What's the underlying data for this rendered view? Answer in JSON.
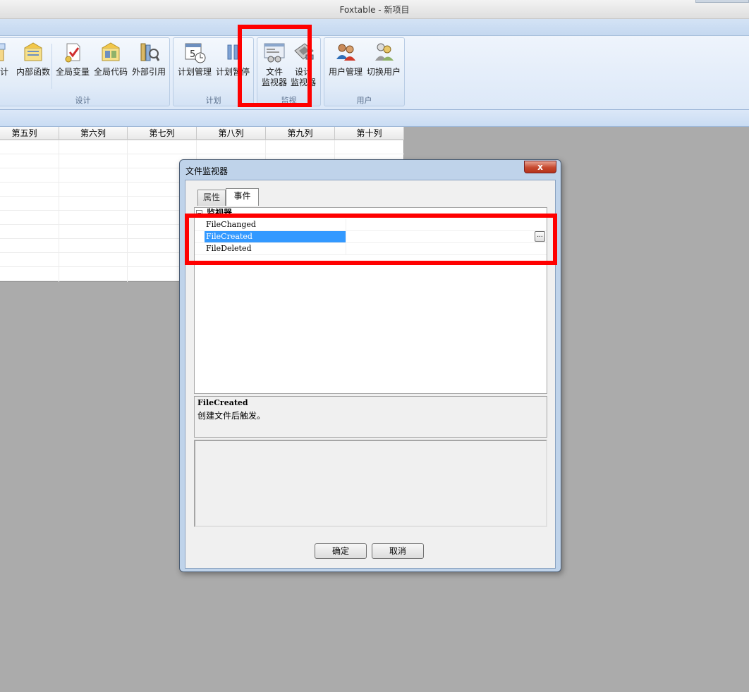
{
  "window": {
    "title": "Foxtable - 新项目"
  },
  "ribbon": {
    "groups": [
      {
        "label": "设计",
        "buttons": [
          {
            "label": "计",
            "icon": "design-icon"
          },
          {
            "label": "内部函数",
            "icon": "internal-function-icon"
          },
          {
            "label": "全局变量",
            "icon": "global-variable-icon"
          },
          {
            "label": "全局代码",
            "icon": "global-code-icon"
          },
          {
            "label": "外部引用",
            "icon": "external-reference-icon"
          }
        ]
      },
      {
        "label": "计划",
        "buttons": [
          {
            "label": "计划管理",
            "icon": "calendar-clock-icon"
          },
          {
            "label": "计划暂停",
            "icon": "pause-icon"
          }
        ]
      },
      {
        "label": "监视",
        "buttons": [
          {
            "label": "文件\n监视器",
            "icon": "file-monitor-icon"
          },
          {
            "label": "设计\n监视器",
            "icon": "design-monitor-icon"
          }
        ]
      },
      {
        "label": "用户",
        "buttons": [
          {
            "label": "用户管理",
            "icon": "user-management-icon"
          },
          {
            "label": "切换用户",
            "icon": "switch-user-icon"
          }
        ]
      }
    ]
  },
  "grid": {
    "columns": [
      "第五列",
      "第六列",
      "第七列",
      "第八列",
      "第九列",
      "第十列"
    ]
  },
  "dialog": {
    "title": "文件监视器",
    "close_label": "x",
    "tabs": [
      "属性",
      "事件"
    ],
    "active_tab": "事件",
    "category": {
      "toggle": "−",
      "label": "监视器"
    },
    "events": [
      {
        "name": "FileChanged",
        "selected": false
      },
      {
        "name": "FileCreated",
        "selected": true
      },
      {
        "name": "FileDeleted",
        "selected": false
      }
    ],
    "ellipsis_label": "...",
    "description": {
      "title": "FileCreated",
      "text": "创建文件后触发。"
    },
    "ok_label": "确定",
    "cancel_label": "取消"
  },
  "colors": {
    "annotation": "#ff0000",
    "selection": "#3399ff",
    "ribbon": "#dce8f8"
  }
}
